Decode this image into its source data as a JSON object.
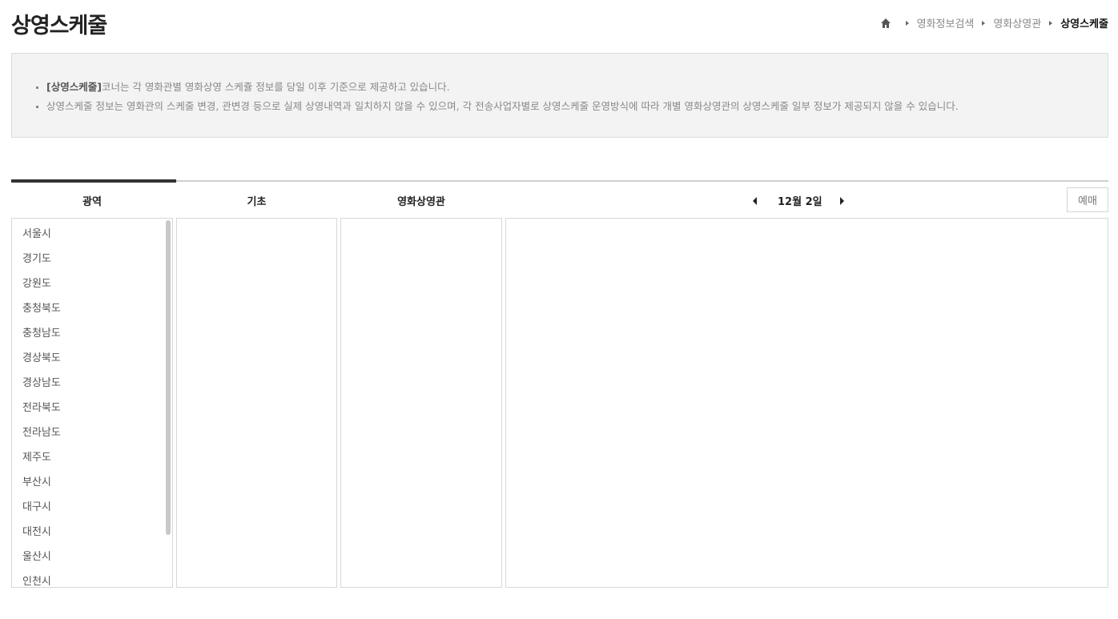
{
  "page": {
    "title": "상영스케줄"
  },
  "breadcrumb": {
    "items": [
      "영화정보검색",
      "영화상영관"
    ],
    "current": "상영스케줄"
  },
  "notice": {
    "line1_bold": "[상영스케줄]",
    "line1_rest": "코너는 각 영화관별 영화상영 스케쥴 정보를 당일 이후 기준으로 제공하고 있습니다.",
    "line2": "상영스케줄 정보는 영화관의 스케줄 변경, 관변경 등으로 실제 상영내역과 일치하지 않을 수 있으며, 각 전송사업자별로 상영스케줄 운영방식에 따라 개별 영화상영관의 상영스케줄 일부 정보가 제공되지 않을 수 있습니다."
  },
  "columns": {
    "region": "광역",
    "basic": "기초",
    "theater": "영화상영관"
  },
  "date": {
    "label": "12월 2일"
  },
  "reserve_label": "예매",
  "regions": [
    "서울시",
    "경기도",
    "강원도",
    "충청북도",
    "충청남도",
    "경상북도",
    "경상남도",
    "전라북도",
    "전라남도",
    "제주도",
    "부산시",
    "대구시",
    "대전시",
    "울산시",
    "인천시"
  ],
  "icons": {
    "home": "home-icon",
    "prev": "caret-left-icon",
    "next": "caret-right-icon"
  }
}
